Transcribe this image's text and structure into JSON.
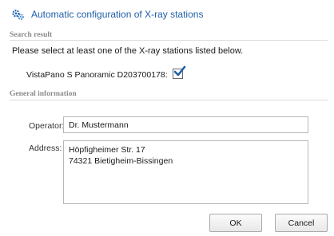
{
  "window": {
    "title": "Automatic configuration of X-ray stations",
    "icon": "gears-icon",
    "accent": "#1f5fa8"
  },
  "search_result": {
    "heading": "Search result",
    "instruction": "Please select at least one of the X-ray stations listed below.",
    "station_label": "VistaPano S Panoramic D203700178:",
    "station_checked": true
  },
  "general_information": {
    "heading": "General information",
    "operator_label": "Operator:",
    "operator_value": "Dr. Mustermann",
    "address_label": "Address:",
    "address_line1": "Höpfigheimer Str. 17",
    "address_line2": "74321 Bietigheim-Bissingen"
  },
  "buttons": {
    "ok": "OK",
    "cancel": "Cancel"
  }
}
